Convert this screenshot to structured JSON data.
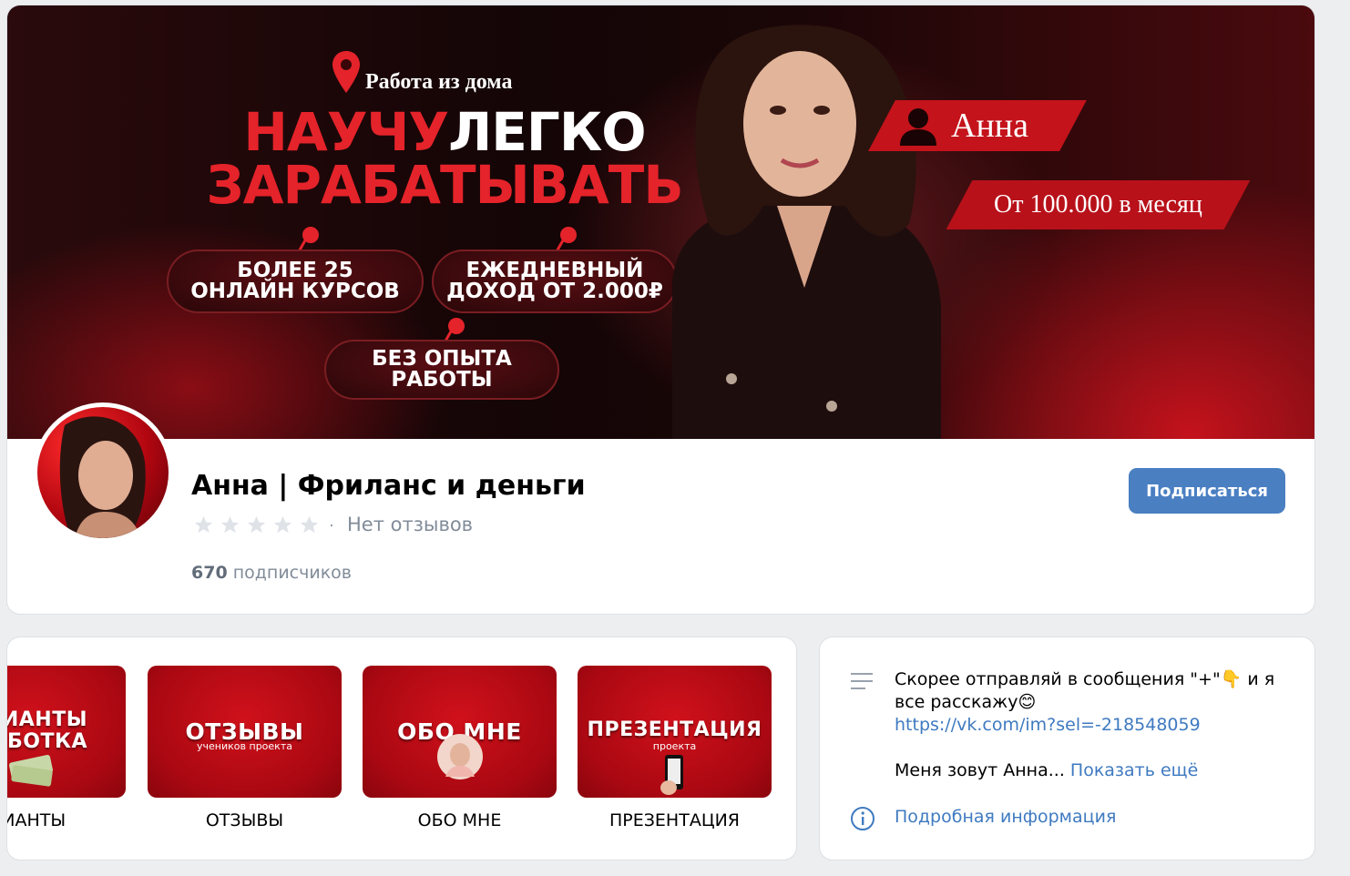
{
  "cover": {
    "location": "Работа из дома",
    "title_red_1": "НАУЧУ",
    "title_white": "ЛЕГКО",
    "title_red_2": "ЗАРАБАТЫВАТЬ",
    "pill_1_line1": "БОЛЕЕ 25",
    "pill_1_line2": "ОНЛАЙН КУРСОВ",
    "pill_2_line1": "ЕЖЕДНЕВНЫЙ",
    "pill_2_line2": "ДОХОД ОТ 2.000₽",
    "pill_3_line1": "БЕЗ ОПЫТА",
    "pill_3_line2": "РАБОТЫ",
    "name_badge": "Анна",
    "income_badge": "От 100.000 в месяц",
    "accent_color": "#c4131b"
  },
  "header": {
    "page_title": "Анна | Фриланс и деньги",
    "rating_text": "Нет отзывов",
    "rating_separator": "·",
    "subscribers_count": "670",
    "subscribers_label": "подписчиков",
    "subscribe_label": "Подписаться",
    "button_color": "#4a7fc2"
  },
  "links": {
    "items": [
      {
        "tile_title": "РИАНТЫ\nАБОТКА",
        "label": "РИАНТЫ"
      },
      {
        "tile_title": "ОТЗЫВЫ",
        "tile_sub": "учеников проекта",
        "label": "ОТЗЫВЫ"
      },
      {
        "tile_title": "ОБО МНЕ",
        "label": "ОБО МНЕ"
      },
      {
        "tile_title": "ПРЕЗЕНТАЦИЯ",
        "tile_sub": "проекта",
        "label": "ПРЕЗЕНТАЦИЯ"
      }
    ]
  },
  "info": {
    "description_line": "Скорее отправляй в сообщения \"+\"👇 и я все расскажу😊",
    "link": "https://vk.com/im?sel=-218548059",
    "intro": "Меня зовут Анна...",
    "show_more": "Показать ещё",
    "details": "Подробная информация",
    "link_color": "#3f7ac0"
  }
}
